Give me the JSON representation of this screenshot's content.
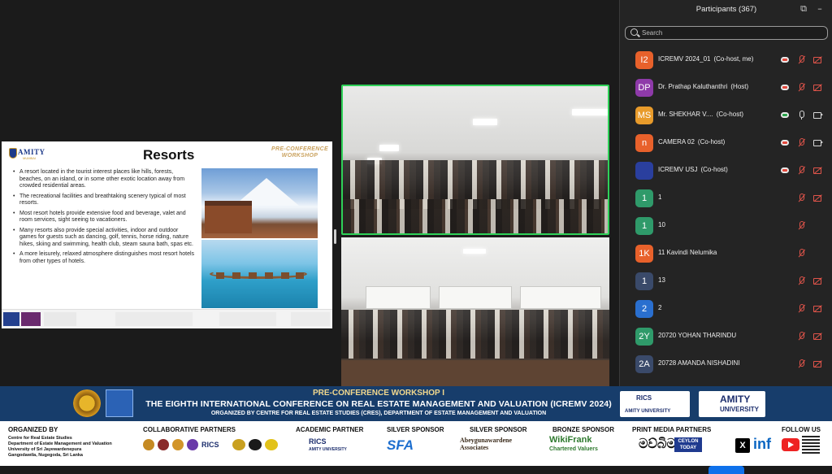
{
  "slide": {
    "brand_name": "AMITY",
    "brand_sub": "UNIVERSITY",
    "brand_city": "MUMBAI",
    "title": "Resorts",
    "stamp": "PRE-CONFERENCE WORKSHOP",
    "bullets": [
      "A resort located in the tourist interest places like hills, forests, beaches, on an island, or in some other exotic location away from crowded residential areas.",
      "The recreational facilities and breathtaking scenery typical of most resorts.",
      "Most resort hotels provide extensive food and beverage, valet and room services, sight seeing to vacationers.",
      "Many resorts also provide special activities, indoor and outdoor games for guests such as dancing, golf, tennis, horse riding, nature hikes, skiing and swimming, health club, steam sauna bath, spas etc.",
      "A more leisurely, relaxed atmosphere distinguishes most resort hotels from other types of hotels."
    ]
  },
  "panel": {
    "title": "Participants (367)",
    "search_placeholder": "Search",
    "participants": [
      {
        "initials": "I2",
        "name": "ICREMV 2024_01",
        "role": "(Co-host, me)",
        "color": "#e8612b",
        "cloud": "red",
        "mic": "off",
        "cam": "off"
      },
      {
        "initials": "DP",
        "name": "Dr. Prathap Kaluthanthri",
        "role": "(Host)",
        "color": "#8e3aa9",
        "cloud": "red",
        "mic": "off",
        "cam": "off"
      },
      {
        "initials": "MS",
        "name": "Mr. SHEKHAR V....",
        "role": "(Co-host)",
        "color": "#e89b2b",
        "cloud": "green",
        "mic": "on",
        "cam": "on"
      },
      {
        "initials": "n",
        "name": "CAMERA 02",
        "role": "(Co-host)",
        "color": "#e8612b",
        "cloud": "red",
        "mic": "off",
        "cam": "on"
      },
      {
        "initials": "",
        "name": "ICREMV USJ",
        "role": "(Co-host)",
        "color": "#2a3f9e",
        "cloud": "red",
        "mic": "off",
        "cam": "off",
        "image": true
      },
      {
        "initials": "1",
        "name": "1",
        "role": "",
        "color": "#2f9a6a",
        "cloud": "",
        "mic": "off",
        "cam": "off"
      },
      {
        "initials": "1",
        "name": "10",
        "role": "",
        "color": "#2f9a6a",
        "cloud": "",
        "mic": "off",
        "cam": ""
      },
      {
        "initials": "1K",
        "name": "11 Kavindi Nelumika",
        "role": "",
        "color": "#e8612b",
        "cloud": "",
        "mic": "off",
        "cam": ""
      },
      {
        "initials": "1",
        "name": "13",
        "role": "",
        "color": "#3a4a6a",
        "cloud": "",
        "mic": "off",
        "cam": "off"
      },
      {
        "initials": "2",
        "name": "2",
        "role": "",
        "color": "#2a6fcf",
        "cloud": "",
        "mic": "off",
        "cam": "off"
      },
      {
        "initials": "2Y",
        "name": "20720 YOHAN THARINDU",
        "role": "",
        "color": "#2f9a6a",
        "cloud": "",
        "mic": "off",
        "cam": "off"
      },
      {
        "initials": "2A",
        "name": "20728 AMANDA NISHADINI",
        "role": "",
        "color": "#3a4a6a",
        "cloud": "",
        "mic": "off",
        "cam": "off"
      }
    ]
  },
  "banner": {
    "line1": "PRE-CONFERENCE WORKSHOP I",
    "line2": "THE EIGHTH INTERNATIONAL CONFERENCE ON REAL ESTATE MANAGEMENT AND VALUATION (ICREMV 2024)",
    "line3": "ORGANIZED BY CENTRE FOR REAL ESTATE STUDIES (CRES), DEPARTMENT OF ESTATE MANAGEMENT AND VALUATION",
    "rics_name": "RICS",
    "rics_sub": "AMITY UNIVERSITY",
    "amity_name": "AMITY",
    "amity_sub": "UNIVERSITY"
  },
  "sponsors": {
    "organized_by": "ORGANIZED BY",
    "org_lines": [
      "Centre for Real Estate Studies",
      "Department of Estate Management and Valuation",
      "University of Sri Jayewardenepura",
      "Gangodawila, Nugegoda, Sri Lanka"
    ],
    "collaborative": "COLLABORATIVE PARTNERS",
    "academic": "ACADEMIC PARTNER",
    "academic_logo": "RICS",
    "academic_logo_sub": "AMITY UNIVERSITY",
    "silver1": "SILVER SPONSOR",
    "silver1_logo": "SFA",
    "silver2": "SILVER SPONSOR",
    "silver2_logo": "Abeygunawardene Associates",
    "bronze": "BRONZE SPONSOR",
    "bronze_logo": "WikiFrank",
    "bronze_logo_sub": "Chartered Valuers",
    "print": "PRINT MEDIA PARTNERS",
    "print_logo1": "මව්බිම",
    "print_logo2": "CEYLON TODAY",
    "follow": "FOLLOW US",
    "follow_x": "X",
    "follow_in": "in",
    "follow_f": "f"
  }
}
